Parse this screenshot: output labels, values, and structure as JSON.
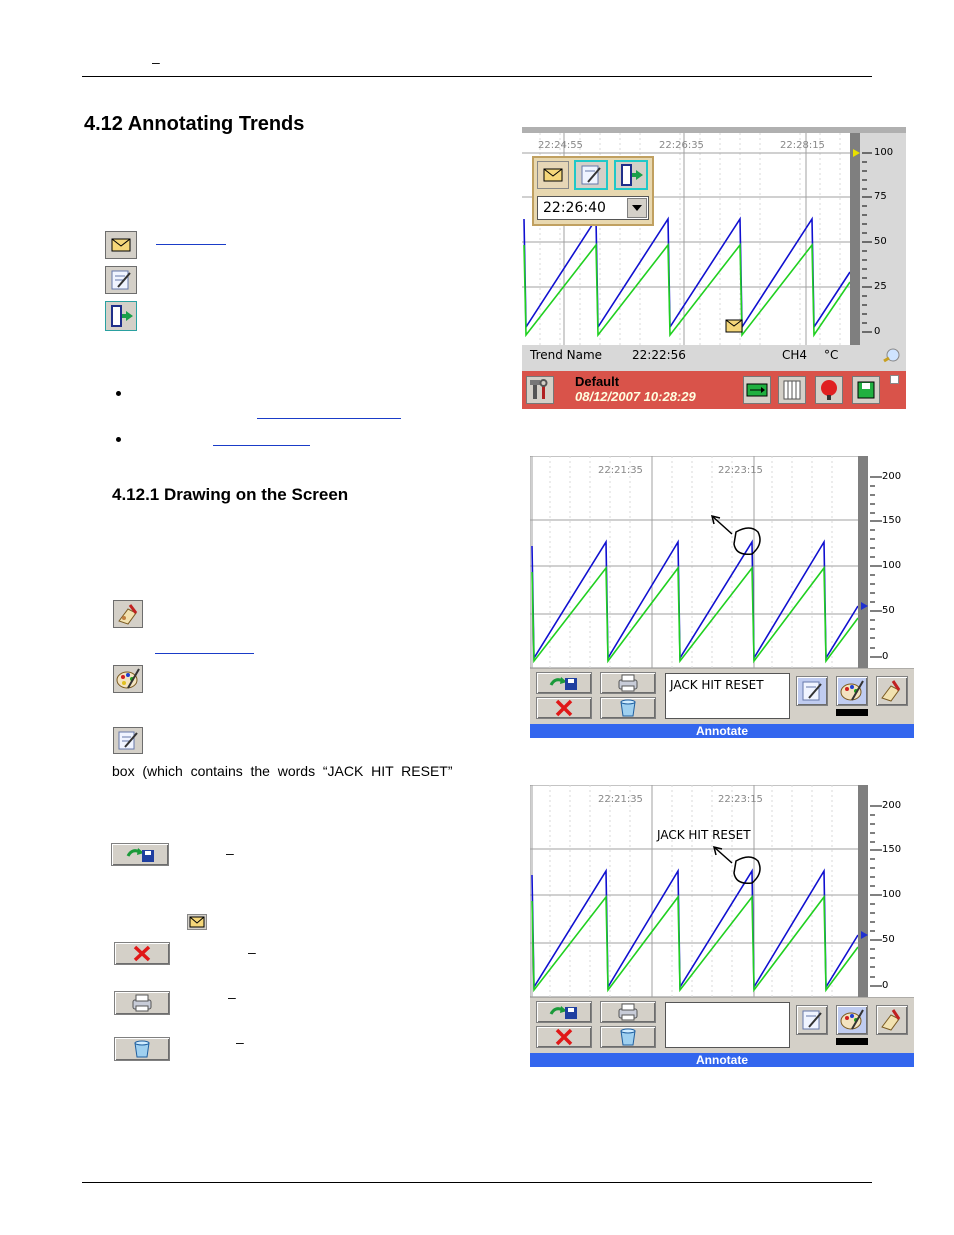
{
  "header": {
    "dash": "–"
  },
  "section": {
    "title": "4.12  Annotating Trends"
  },
  "subsection": {
    "title": "4.12.1  Drawing on the Screen"
  },
  "body_text": {
    "box_text": "box  (which  contains  the  words  “JACK  HIT  RESET”",
    "dash1": "–",
    "dash2": "–",
    "dash3": "–",
    "dash4": "–"
  },
  "screen1": {
    "times": [
      "22:24:55",
      "22:26:35",
      "22:28:15"
    ],
    "scale": [
      "100",
      "75",
      "50",
      "25",
      "0"
    ],
    "time_select": "22:26:40",
    "status_trend": "Trend Name",
    "status_time": "22:22:56",
    "status_channel": "CH4",
    "status_unit": "°C",
    "bar_name": "Default",
    "bar_datetime": "08/12/2007 10:28:29"
  },
  "screen2": {
    "times": [
      "22:21:35",
      "22:23:15"
    ],
    "scale": [
      "200",
      "150",
      "100",
      "50",
      "0"
    ],
    "text_box": "JACK HIT RESET",
    "bar_label": "Annotate"
  },
  "screen3": {
    "times": [
      "22:21:35",
      "22:23:15"
    ],
    "scale": [
      "200",
      "150",
      "100",
      "50",
      "0"
    ],
    "annotation": "JACK HIT RESET",
    "text_box": "",
    "bar_label": "Annotate"
  },
  "colors": {
    "trend_blue": "#1010d0",
    "trend_green": "#20d020",
    "status_red": "#d9534a",
    "annotate_blue": "#3366ee",
    "tool_gray": "#d4d0c8",
    "chart_bg": "#ffffff",
    "scale_bar": "#7f7f7f"
  },
  "icons": [
    "envelope-icon",
    "annotate-edit-icon",
    "exit-door-icon",
    "pen-drawing-icon",
    "palette-icon",
    "save-icon",
    "cancel-x-icon",
    "print-icon",
    "trash-bucket-icon"
  ]
}
